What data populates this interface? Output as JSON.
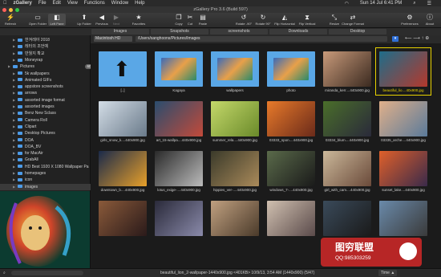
{
  "menubar": {
    "apple": "",
    "app": "zGallery",
    "items": [
      "File",
      "Edit",
      "View",
      "Functions",
      "Window",
      "Help"
    ],
    "date": "Sun 14 Jul  6:41 PM"
  },
  "window": {
    "title": "zGallery Pro 3.6 (Build 597)"
  },
  "toolbar": {
    "refresh": "Refresh",
    "open_folder": "Open Folder",
    "left_pane": "Left Pane",
    "up_folder": "Up Folder",
    "previous": "Previous",
    "next": "Next",
    "favorites": "Favorites",
    "copy": "Copy",
    "cut": "Cut",
    "paste": "Paste",
    "rotate_90_left": "Rotate -90°",
    "rotate_90_right": "Rotate 90°",
    "flip_h": "Flip Horizontal",
    "flip_v": "Flip Vertical",
    "resize": "Resize",
    "change_format": "Change Format",
    "preferences": "Preferences",
    "about": "About"
  },
  "pathbar": {
    "tabs": [
      "Images",
      "Snapshots",
      "screenshots",
      "Downloads",
      "Desktop"
    ],
    "drive": "Macintosh HD",
    "path": "/Users/sanghoons/Pictures/Images"
  },
  "sidebar": {
    "items": [
      {
        "label": "한겨레야 2018",
        "badge": ""
      },
      {
        "label": "레터의 조언예",
        "badge": ""
      },
      {
        "label": "반월지 확교",
        "badge": ""
      },
      {
        "label": "Moneyrap",
        "badge": "45"
      },
      {
        "label": "Pictures",
        "badge": "606"
      },
      {
        "label": "5k wallpapers",
        "badge": ""
      },
      {
        "label": "Animated GIFs",
        "badge": "32"
      },
      {
        "label": "appstore screenshots",
        "badge": ""
      },
      {
        "label": "arrows",
        "badge": ""
      },
      {
        "label": "assorted image format",
        "badge": ""
      },
      {
        "label": "assorted images",
        "badge": ""
      },
      {
        "label": "Benz New Sclass",
        "badge": ""
      },
      {
        "label": "Camera Roll",
        "badge": ""
      },
      {
        "label": "Clipart",
        "badge": ""
      },
      {
        "label": "Desktop Pictures",
        "badge": ""
      },
      {
        "label": "DOA",
        "badge": ""
      },
      {
        "label": "DOA_BV",
        "badge": ""
      },
      {
        "label": "for MacAir",
        "badge": ""
      },
      {
        "label": "GrabAll",
        "badge": ""
      },
      {
        "label": "HD Best 1920 X 1080 Wallpaper Pa",
        "badge": ""
      },
      {
        "label": "homepages",
        "badge": ""
      },
      {
        "label": "icon",
        "badge": ""
      },
      {
        "label": "images",
        "badge": "47"
      }
    ]
  },
  "grid": {
    "items": [
      {
        "caption": "[..]",
        "kind": "up"
      },
      {
        "caption": "Kagaya",
        "kind": "folder"
      },
      {
        "caption": "wallpapers",
        "kind": "folder"
      },
      {
        "caption": "photo",
        "kind": "folder"
      },
      {
        "caption": "miranda_kerr....440x900.jpg",
        "kind": "img",
        "c1": "#c89a7a",
        "c2": "#3b2a20"
      },
      {
        "caption": "beautiful_lio....40x900.jpg",
        "kind": "img",
        "c1": "#1e6d8a",
        "c2": "#b4382c"
      },
      {
        "caption": "girls_snow_k....440x900.jpg",
        "kind": "img",
        "c1": "#d3dde6",
        "c2": "#6a7a8a"
      },
      {
        "caption": "art_15-wallpa....440x900.jpg",
        "kind": "img",
        "c1": "#2a4d6e",
        "c2": "#c24a3a"
      },
      {
        "caption": "summer_rela....440x900.jpg",
        "kind": "img",
        "c1": "#c4d86a",
        "c2": "#6a8a2a"
      },
      {
        "caption": "03333_spon....440x900.jpg",
        "kind": "img",
        "c1": "#e87a2a",
        "c2": "#6a2a1a"
      },
      {
        "caption": "03334_blum....440x900.jpg",
        "kind": "img",
        "c1": "#4a6e2a",
        "c2": "#2a2a3a"
      },
      {
        "caption": "03335_arche....440x900.jpg",
        "kind": "img",
        "c1": "#e0b08a",
        "c2": "#5a7a9a"
      },
      {
        "caption": "downtown_b....440x900.jpg",
        "kind": "img",
        "c1": "#1a2a4a",
        "c2": "#e8a02a"
      },
      {
        "caption": "lotus_exige-....440x900.jpg",
        "kind": "img",
        "c1": "#2a2a2a",
        "c2": "#bbbbbb"
      },
      {
        "caption": "hippies_ver-....440x900.jpg",
        "kind": "img",
        "c1": "#3a3a2a",
        "c2": "#aa8a5a"
      },
      {
        "caption": "windows_7-....440x900.jpg",
        "kind": "img",
        "c1": "#5a6a4a",
        "c2": "#1a1a1a"
      },
      {
        "caption": "girl_with_cam....440x900.jpg",
        "kind": "img",
        "c1": "#cbb89a",
        "c2": "#6a4a3a"
      },
      {
        "caption": "sunset_lake....440x900.jpg",
        "kind": "img",
        "c1": "#e0602a",
        "c2": "#3a2a4a"
      },
      {
        "caption": "",
        "kind": "img",
        "c1": "#8a5a3a",
        "c2": "#2a1a1a"
      },
      {
        "caption": "",
        "kind": "img",
        "c1": "#2a2a3a",
        "c2": "#8a8aaa"
      },
      {
        "caption": "",
        "kind": "img",
        "c1": "#c0a080",
        "c2": "#4a3a2a"
      },
      {
        "caption": "",
        "kind": "img",
        "c1": "#d0c0b0",
        "c2": "#5a4a4a"
      },
      {
        "caption": "",
        "kind": "img",
        "c1": "#3a4a5a",
        "c2": "#1a1a1a"
      },
      {
        "caption": "",
        "kind": "img",
        "c1": "#6a8aaa",
        "c2": "#3a3a3a"
      }
    ]
  },
  "statusbar": {
    "text": "beautiful_lion_2-wallpaper-1440x900.jpg  <401KB>  10/9/13, 3:54 AM  (1440x900)  (5/47)",
    "sort": "Time ▲"
  },
  "watermark": {
    "line1": "图穷联盟",
    "line2": "QQ:985303259"
  },
  "colors": {
    "accent": "#e8d200",
    "folder": "#5aa7e6",
    "selection": "#e8d200"
  }
}
